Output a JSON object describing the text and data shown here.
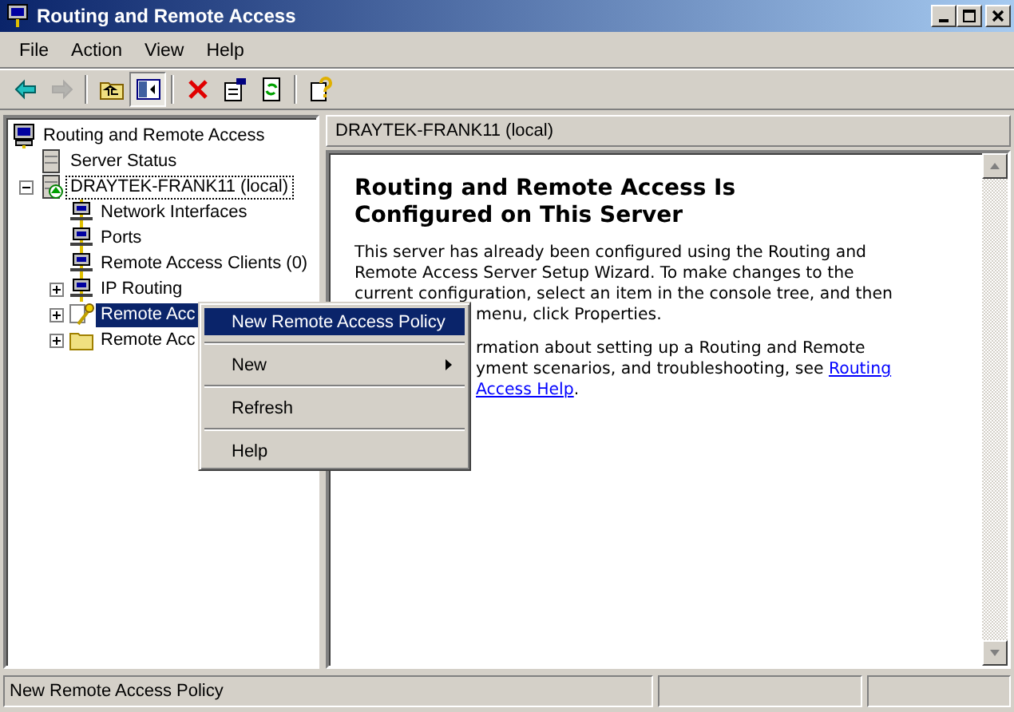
{
  "window": {
    "title": "Routing and Remote Access"
  },
  "menu_bar": [
    {
      "label": "File"
    },
    {
      "label": "Action"
    },
    {
      "label": "View"
    },
    {
      "label": "Help"
    }
  ],
  "toolbar": [
    {
      "kind": "back",
      "disabled": false,
      "pressed": false
    },
    {
      "kind": "forward",
      "disabled": true,
      "pressed": false
    },
    {
      "kind": "separator"
    },
    {
      "kind": "up",
      "disabled": false,
      "pressed": false
    },
    {
      "kind": "tree-toggle",
      "disabled": false,
      "pressed": true
    },
    {
      "kind": "separator"
    },
    {
      "kind": "delete",
      "disabled": false,
      "pressed": false
    },
    {
      "kind": "properties",
      "disabled": false,
      "pressed": false
    },
    {
      "kind": "refresh",
      "disabled": false,
      "pressed": false
    },
    {
      "kind": "separator"
    },
    {
      "kind": "help",
      "disabled": false,
      "pressed": false
    }
  ],
  "tree": [
    {
      "label": "Routing and Remote Access",
      "kind": "computer",
      "selected": false,
      "focused": false,
      "children": [
        {
          "label": "Server Status",
          "kind": "server",
          "selected": false,
          "focused": false
        },
        {
          "label": "DRAYTEK-FRANK11 (local)",
          "kind": "server-up",
          "expanded": true,
          "selected": false,
          "focused": true,
          "children": [
            {
              "label": "Network Interfaces",
              "kind": "network",
              "selected": false,
              "focused": false
            },
            {
              "label": "Ports",
              "kind": "network",
              "selected": false,
              "focused": false
            },
            {
              "label": "Remote Access Clients (0)",
              "kind": "network",
              "selected": false,
              "focused": false
            },
            {
              "label": "IP Routing",
              "kind": "network",
              "expanded": false,
              "selected": false,
              "focused": false
            },
            {
              "label": "Remote Acc",
              "kind": "policy",
              "expanded": false,
              "selected": true,
              "focused": false
            },
            {
              "label": "Remote Acc",
              "kind": "folder",
              "expanded": false,
              "selected": false,
              "focused": false
            }
          ]
        }
      ]
    }
  ],
  "details": {
    "header": "DRAYTEK-FRANK11 (local)",
    "heading": [
      "Routing and Remote Access Is",
      "Configured on This Server"
    ],
    "lines": [
      {
        "covered": false,
        "parts": [
          {
            "text": "This server has already been configured using the Routing and",
            "link": false
          }
        ]
      },
      {
        "covered": false,
        "parts": [
          {
            "text": "Remote Access Server Setup Wizard. To make changes to the",
            "link": false
          }
        ]
      },
      {
        "covered": false,
        "parts": [
          {
            "text": "current configuration, select an item in the console tree, and then",
            "link": false
          }
        ]
      },
      {
        "covered": true,
        "parts": [
          {
            "text": "menu, click Properties.",
            "link": false
          }
        ]
      },
      {
        "covered": true,
        "gap": true,
        "parts": [
          {
            "text": "rmation about setting up a Routing and Remote",
            "link": false
          }
        ]
      },
      {
        "covered": true,
        "parts": [
          {
            "text": "yment scenarios, and troubleshooting, see ",
            "link": false
          },
          {
            "text": "Routing",
            "link": true
          }
        ]
      },
      {
        "covered": true,
        "parts": [
          {
            "text": "Access Help",
            "link": true
          },
          {
            "text": ".",
            "link": false
          }
        ]
      }
    ]
  },
  "context_menu": [
    {
      "kind": "item",
      "label": "New Remote Access Policy",
      "selected": true,
      "submenu": false
    },
    {
      "kind": "separator"
    },
    {
      "kind": "item",
      "label": "New",
      "selected": false,
      "submenu": true
    },
    {
      "kind": "separator"
    },
    {
      "kind": "item",
      "label": "Refresh",
      "selected": false,
      "submenu": false
    },
    {
      "kind": "separator"
    },
    {
      "kind": "item",
      "label": "Help",
      "selected": false,
      "submenu": false
    }
  ],
  "status_bar": {
    "text": "New Remote Access Policy"
  }
}
